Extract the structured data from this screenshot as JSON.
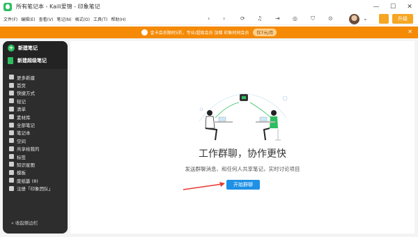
{
  "titlebar": {
    "title": "所有笔记本 - Kaili爱锦 - 印象笔记"
  },
  "menu": [
    "文件(F)",
    "编辑(E)",
    "查看(V)",
    "笔记(N)",
    "格式(O)",
    "工具(T)",
    "帮助(H)"
  ],
  "header": {
    "upgrade_label": "升级"
  },
  "promo": {
    "text": "金卡会员限时5折，专业/超级会员 加赠 印象时间会员",
    "tag": "仅7元/月"
  },
  "sidebar": {
    "new_note": "新建笔记",
    "new_super_note": "新建超级笔记",
    "items": [
      {
        "label": "更多新建",
        "icon": "grid-icon"
      },
      {
        "label": "首页",
        "icon": "home-icon"
      },
      {
        "label": "快捷方式",
        "icon": "star-icon"
      },
      {
        "label": "轻记",
        "icon": "pencil-icon"
      },
      {
        "label": "清单",
        "icon": "checklist-icon"
      },
      {
        "label": "素材库",
        "icon": "library-icon"
      },
      {
        "label": "全部笔记",
        "icon": "notes-icon"
      },
      {
        "label": "笔记本",
        "icon": "notebook-icon"
      },
      {
        "label": "空间",
        "icon": "space-icon"
      },
      {
        "label": "共享给我的",
        "icon": "shared-icon"
      },
      {
        "label": "标签",
        "icon": "tag-icon"
      },
      {
        "label": "知识星图",
        "icon": "graph-icon"
      },
      {
        "label": "模板",
        "icon": "template-icon"
      },
      {
        "label": "废纸篓 (8)",
        "icon": "trash-icon"
      },
      {
        "label": "注册「印象团队」",
        "icon": "team-icon"
      }
    ],
    "collapse": "收起侧边栏"
  },
  "content": {
    "heading": "工作群聊，协作更快",
    "subtitle": "发送群聊消息、和任何人共享笔记，实时讨论项目",
    "button": "开始群聊"
  }
}
